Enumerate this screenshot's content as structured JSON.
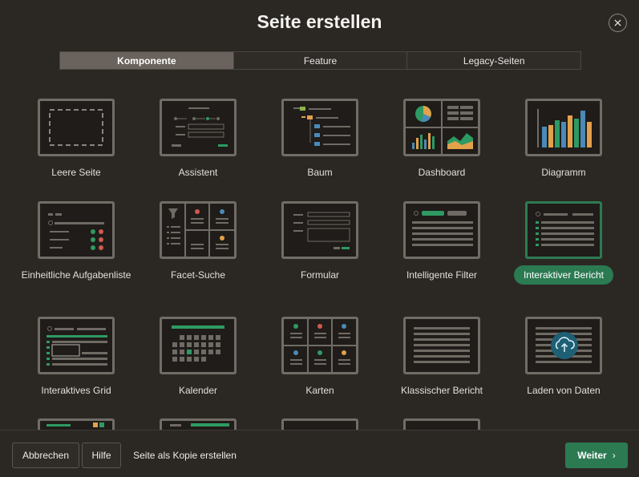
{
  "dialog": {
    "title": "Seite erstellen",
    "close_icon": "close-icon"
  },
  "tabs": [
    {
      "label": "Komponente",
      "active": true
    },
    {
      "label": "Feature",
      "active": false
    },
    {
      "label": "Legacy-Seiten",
      "active": false
    }
  ],
  "tiles": [
    {
      "label": "Leere Seite",
      "icon": "blank-page-icon"
    },
    {
      "label": "Assistent",
      "icon": "wizard-icon"
    },
    {
      "label": "Baum",
      "icon": "tree-icon"
    },
    {
      "label": "Dashboard",
      "icon": "dashboard-icon"
    },
    {
      "label": "Diagramm",
      "icon": "chart-icon"
    },
    {
      "label": "Einheitliche Aufgabenliste",
      "icon": "task-list-icon"
    },
    {
      "label": "Facet-Suche",
      "icon": "facet-search-icon"
    },
    {
      "label": "Formular",
      "icon": "form-icon"
    },
    {
      "label": "Intelligente Filter",
      "icon": "smart-filter-icon"
    },
    {
      "label": "Interaktiver Bericht",
      "icon": "interactive-report-icon",
      "selected": true
    },
    {
      "label": "Interaktives Grid",
      "icon": "interactive-grid-icon"
    },
    {
      "label": "Kalender",
      "icon": "calendar-icon"
    },
    {
      "label": "Karten",
      "icon": "cards-icon"
    },
    {
      "label": "Klassischer Bericht",
      "icon": "classic-report-icon"
    },
    {
      "label": "Laden von Daten",
      "icon": "data-load-icon"
    }
  ],
  "footer": {
    "cancel_label": "Abbrechen",
    "help_label": "Hilfe",
    "copy_label": "Seite als Kopie erstellen",
    "next_label": "Weiter"
  },
  "colors": {
    "accent": "#2b7a52",
    "background": "#2b2824"
  }
}
